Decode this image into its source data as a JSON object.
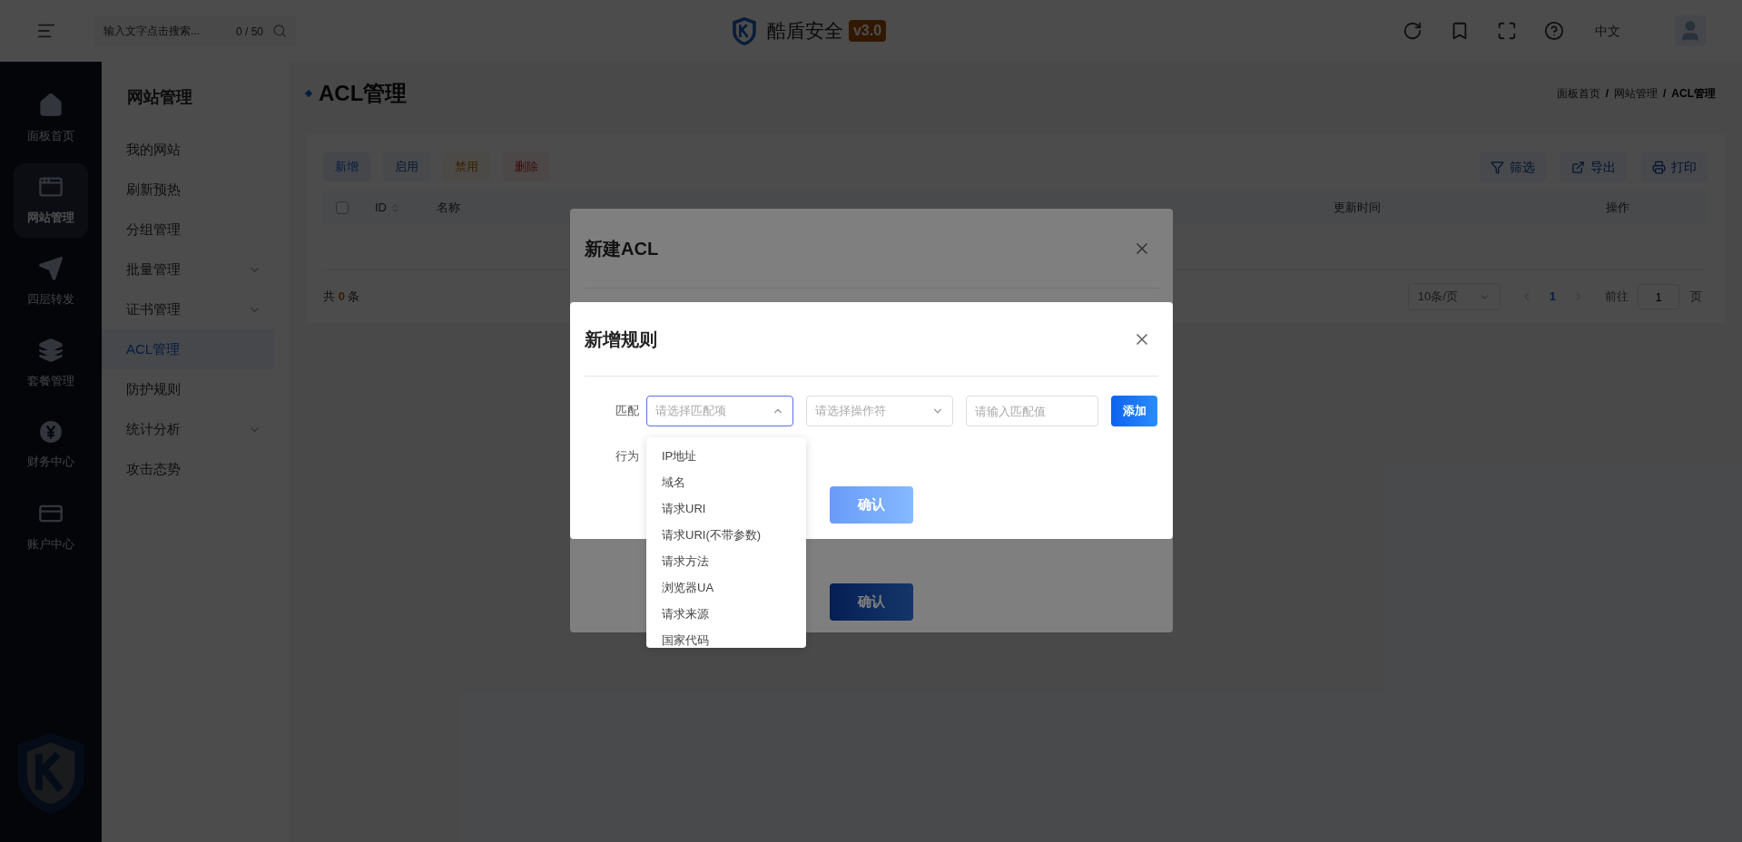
{
  "topbar": {
    "search": {
      "placeholder": "输入文字点击搜索...",
      "counter": "0 / 50"
    },
    "brand": {
      "name": "酷盾安全",
      "version": "v3.0"
    },
    "language": "中文"
  },
  "nav_rail": [
    {
      "label": "面板首页",
      "kind": "home",
      "selected": false
    },
    {
      "label": "网站管理",
      "kind": "window",
      "selected": true
    },
    {
      "label": "四层转发",
      "kind": "plane",
      "selected": false
    },
    {
      "label": "套餐管理",
      "kind": "layers",
      "selected": false
    },
    {
      "label": "财务中心",
      "kind": "yen",
      "selected": false
    },
    {
      "label": "账户中心",
      "kind": "card",
      "selected": false
    }
  ],
  "subnav": {
    "title": "网站管理",
    "items": [
      {
        "label": "我的网站",
        "expandable": false,
        "selected": false
      },
      {
        "label": "刷新预热",
        "expandable": false,
        "selected": false
      },
      {
        "label": "分组管理",
        "expandable": false,
        "selected": false
      },
      {
        "label": "批量管理",
        "expandable": true,
        "selected": false
      },
      {
        "label": "证书管理",
        "expandable": true,
        "selected": false
      },
      {
        "label": "ACL管理",
        "expandable": false,
        "selected": true
      },
      {
        "label": "防护规则",
        "expandable": false,
        "selected": false
      },
      {
        "label": "统计分析",
        "expandable": true,
        "selected": false
      },
      {
        "label": "攻击态势",
        "expandable": false,
        "selected": false
      }
    ]
  },
  "page": {
    "title": "ACL管理",
    "breadcrumbs": [
      {
        "label": "面板首页",
        "current": false
      },
      {
        "separator": "/"
      },
      {
        "label": "网站管理",
        "current": false
      },
      {
        "separator": "/"
      },
      {
        "label": "ACL管理",
        "current": true
      }
    ]
  },
  "toolbar": {
    "actions": [
      {
        "label": "新增",
        "kind": "primary"
      },
      {
        "label": "启用",
        "kind": "info"
      },
      {
        "label": "禁用",
        "kind": "warning"
      },
      {
        "label": "删除",
        "kind": "danger"
      }
    ],
    "tools": [
      {
        "label": "筛选",
        "kind": "filter"
      },
      {
        "label": "导出",
        "kind": "export"
      },
      {
        "label": "打印",
        "kind": "print"
      }
    ]
  },
  "table": {
    "select_all": {
      "checked": false
    },
    "columns": [
      {
        "label": "ID",
        "sortable": true
      },
      {
        "label": "名称",
        "sortable": false
      },
      {
        "label": "更新时间",
        "sortable": false
      },
      {
        "label": "操作",
        "sortable": false
      }
    ]
  },
  "pagination": {
    "total_prefix": "共",
    "total": "0",
    "total_suffix": "条",
    "page_size": "10条/页",
    "pages": [
      {
        "label": "1",
        "selected": true
      }
    ],
    "goto_label": "前往",
    "goto_value": "1",
    "goto_suffix": "页"
  },
  "acl_dialog": {
    "title": "新建ACL",
    "confirm": "确认"
  },
  "rule_dialog": {
    "title": "新增规则",
    "match_label": "匹配",
    "match_select": {
      "placeholder": "请选择匹配项",
      "expanded": true
    },
    "operator_select": {
      "placeholder": "请选择操作符",
      "expanded": false
    },
    "value_field": {
      "placeholder": "请输入匹配值"
    },
    "add_button": "添加",
    "action_label": "行为",
    "confirm": "确认",
    "dropdown": [
      "IP地址",
      "域名",
      "请求URI",
      "请求URI(不带参数)",
      "请求方法",
      "浏览器UA",
      "请求来源",
      "国家代码"
    ]
  }
}
